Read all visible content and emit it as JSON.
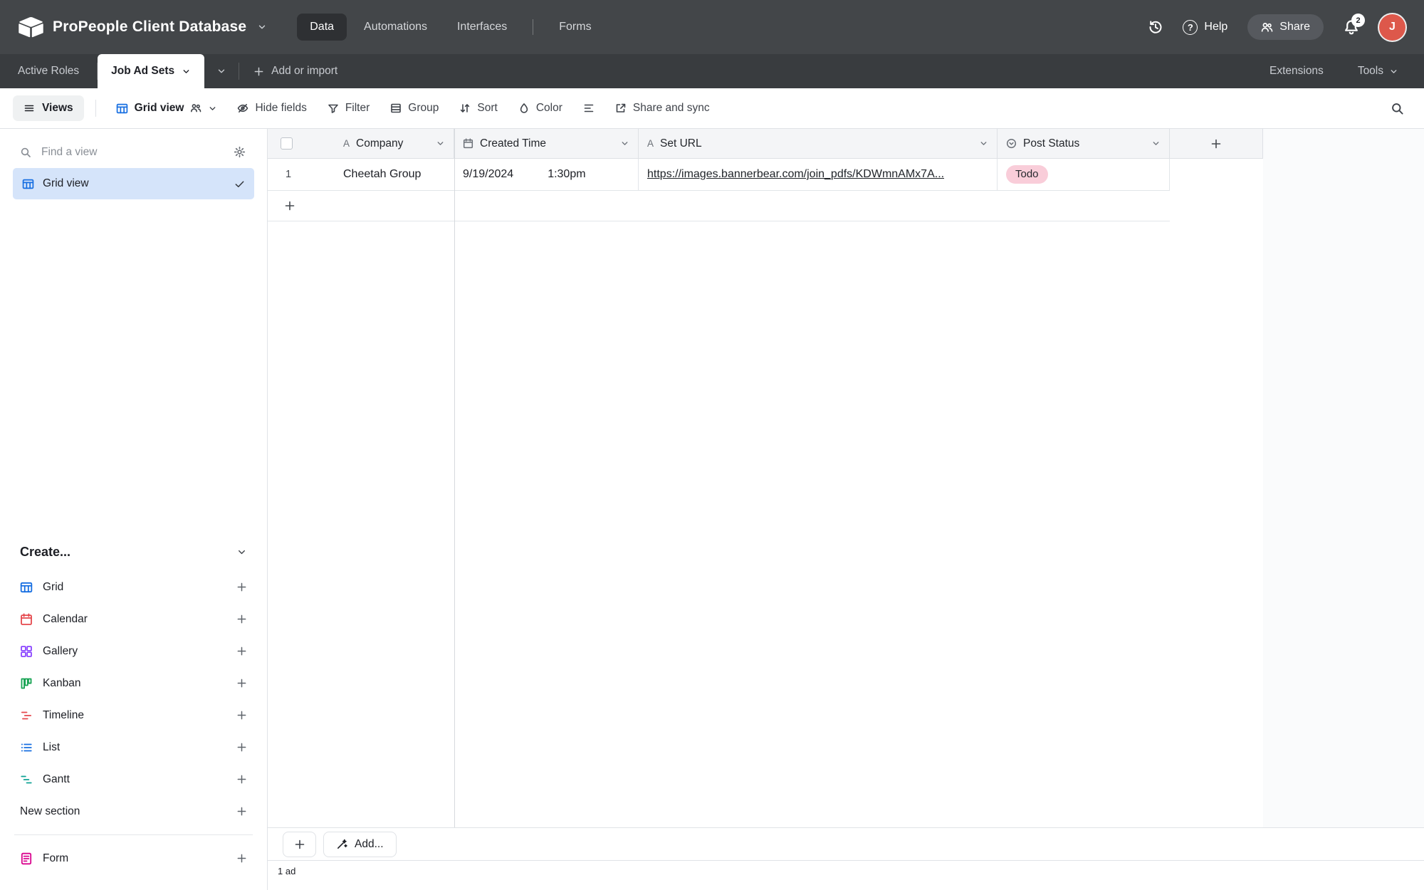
{
  "colors": {
    "topbar_bg": "#434649",
    "accent_blue": "#166ee1",
    "selected_view_bg": "#d5e4fa",
    "todo_pill_bg": "#f9cdd9",
    "avatar_bg": "#dd584b"
  },
  "icons": {
    "text_field_glyph": "A",
    "help_glyph": "?"
  },
  "topbar": {
    "app_title": "ProPeople Client Database",
    "nav": [
      {
        "label": "Data",
        "active": true
      },
      {
        "label": "Automations",
        "active": false
      },
      {
        "label": "Interfaces",
        "active": false
      },
      {
        "label": "Forms",
        "active": false
      }
    ],
    "help_label": "Help",
    "share_label": "Share",
    "notification_count": "2",
    "avatar_initial": "J"
  },
  "tabbar": {
    "tabs": [
      {
        "label": "Active Roles",
        "active": false
      },
      {
        "label": "Job Ad Sets",
        "active": true
      }
    ],
    "add_or_import": "Add or import",
    "extensions": "Extensions",
    "tools": "Tools"
  },
  "toolbar": {
    "views": "Views",
    "view_name": "Grid view",
    "hide_fields": "Hide fields",
    "filter": "Filter",
    "group": "Group",
    "sort": "Sort",
    "color": "Color",
    "share_sync": "Share and sync"
  },
  "sidebar": {
    "search_placeholder": "Find a view",
    "active_view": "Grid view",
    "create_header": "Create...",
    "create_items": [
      {
        "label": "Grid"
      },
      {
        "label": "Calendar"
      },
      {
        "label": "Gallery"
      },
      {
        "label": "Kanban"
      },
      {
        "label": "Timeline"
      },
      {
        "label": "List"
      },
      {
        "label": "Gantt"
      },
      {
        "label": "New section"
      }
    ],
    "form_item": "Form"
  },
  "grid": {
    "columns": [
      {
        "label": "Company",
        "type": "text"
      },
      {
        "label": "Created Time",
        "type": "date"
      },
      {
        "label": "Set URL",
        "type": "text"
      },
      {
        "label": "Post Status",
        "type": "single_select"
      }
    ],
    "rows": [
      {
        "num": "1",
        "company": "Cheetah Group",
        "date": "9/19/2024",
        "time": "1:30pm",
        "url": "https://images.bannerbear.com/join_pdfs/KDWmnAMx7A...",
        "status": "Todo"
      }
    ],
    "footer": {
      "add_button": "Add...",
      "record_count": "1 ad"
    }
  }
}
